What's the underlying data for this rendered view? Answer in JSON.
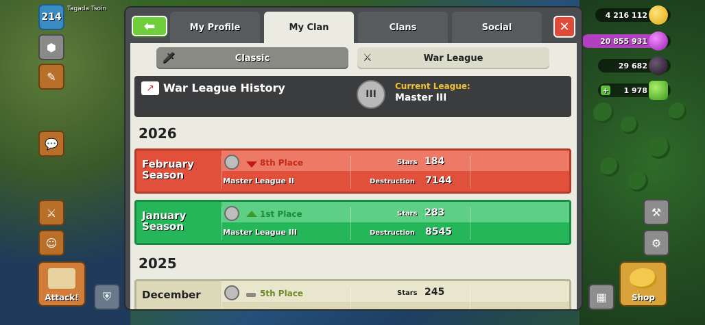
{
  "player": {
    "level": "214",
    "name": "Tagada Tsoin"
  },
  "hud_left": {
    "attack_label": "Attack!"
  },
  "resources": {
    "gold": "4 216 112",
    "elixir": "20 855 931",
    "dark_elixir": "29 682",
    "gems": "1 978"
  },
  "hud_right": {
    "shop_label": "Shop"
  },
  "tabs": [
    "My Profile",
    "My Clan",
    "Clans",
    "Social"
  ],
  "active_tab": "My Clan",
  "subtabs": [
    "Classic",
    "War League"
  ],
  "history": {
    "title": "War League History",
    "current_league_label": "Current League:",
    "current_league_value": "Master III"
  },
  "years": [
    {
      "year": "2026",
      "seasons": [
        {
          "name": "February Season",
          "place": "8th Place",
          "trend": "down",
          "league": "Master League II",
          "stars_label": "Stars",
          "stars": "184",
          "destruction_label": "Destruction",
          "destruction": "7144"
        },
        {
          "name": "January Season",
          "place": "1st Place",
          "trend": "up",
          "league": "Master League III",
          "stars_label": "Stars",
          "stars": "283",
          "destruction_label": "Destruction",
          "destruction": "8545"
        }
      ]
    },
    {
      "year": "2025",
      "seasons": [
        {
          "name": "December",
          "place": "5th Place",
          "trend": "flat",
          "stars_label": "Stars",
          "stars": "245"
        }
      ]
    }
  ],
  "colors": {
    "red_row": "#e0503a",
    "green_row": "#26b65a",
    "tan_row": "#dcd9b8",
    "accent_gold": "#f2c030"
  }
}
